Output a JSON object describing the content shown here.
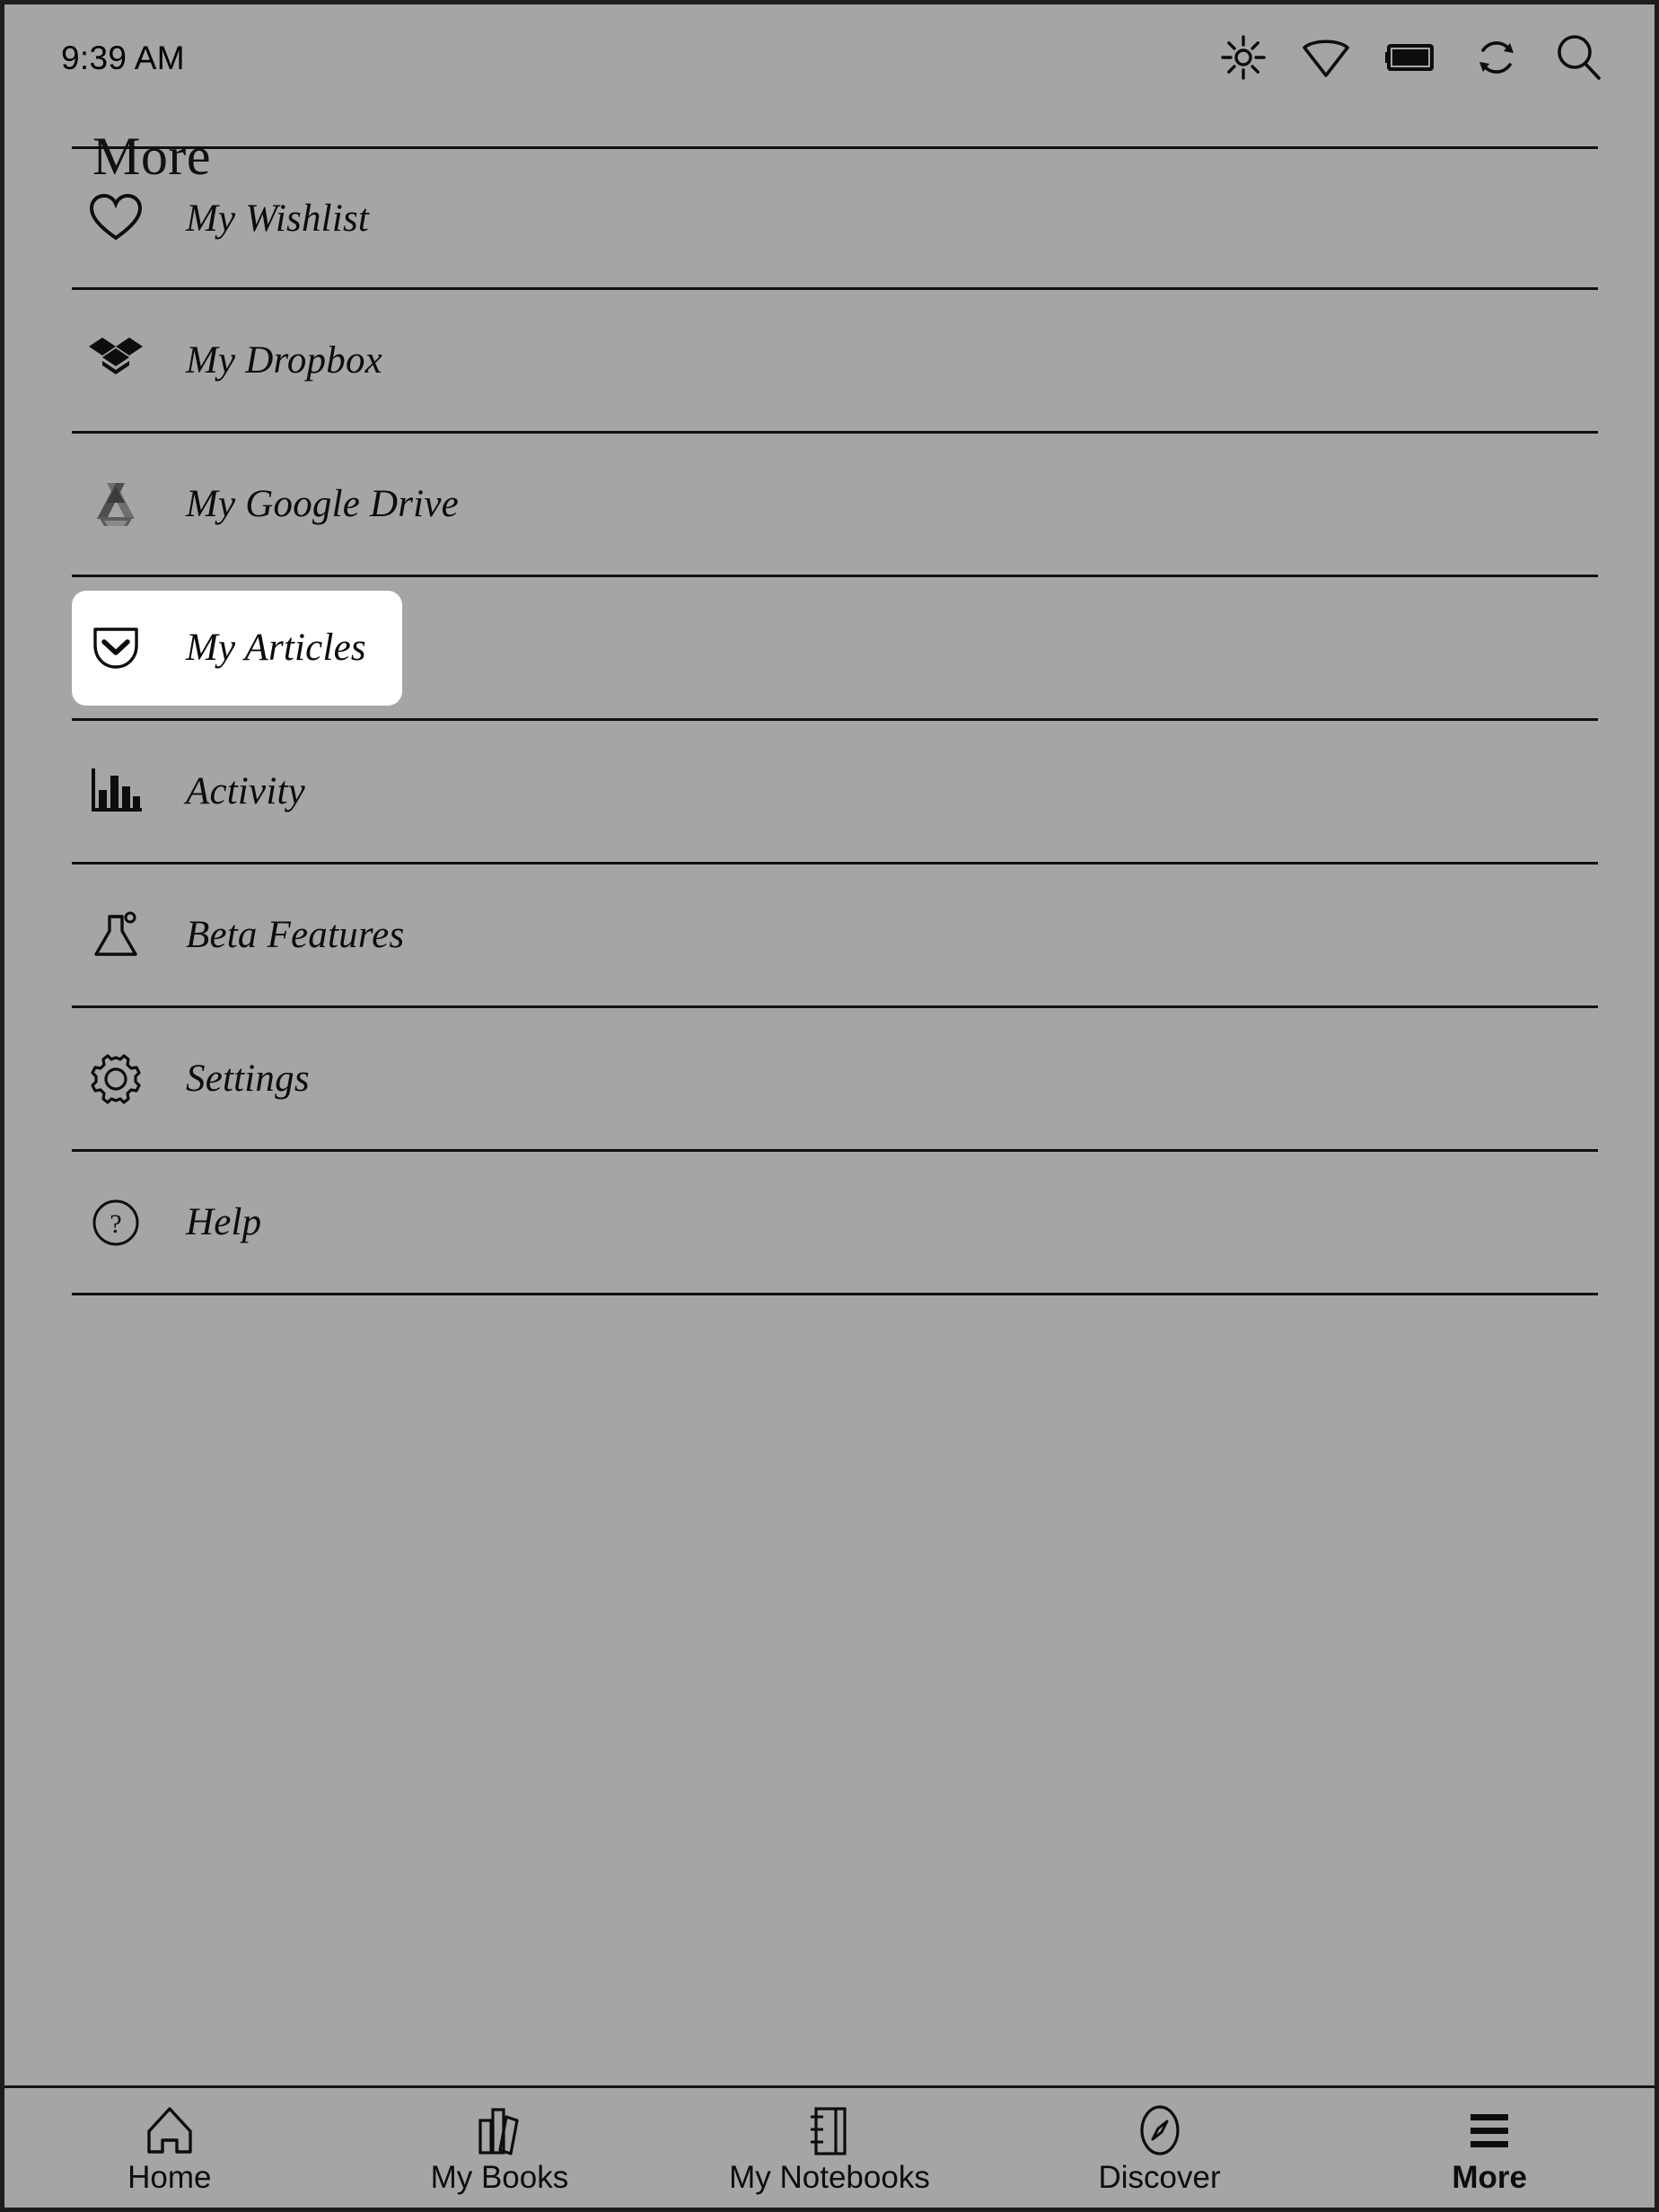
{
  "status_bar": {
    "time": "9:39 AM",
    "icons": [
      {
        "name": "brightness-icon",
        "label": "Brightness"
      },
      {
        "name": "wifi-icon",
        "label": "Wi-Fi"
      },
      {
        "name": "battery-icon",
        "label": "Battery"
      },
      {
        "name": "sync-icon",
        "label": "Sync"
      },
      {
        "name": "search-icon",
        "label": "Search"
      }
    ]
  },
  "header": {
    "title": "More"
  },
  "menu": {
    "items": [
      {
        "label": "My Wishlist",
        "icon": "heart-icon",
        "selected": false
      },
      {
        "label": "My Dropbox",
        "icon": "dropbox-icon",
        "selected": false
      },
      {
        "label": "My Google Drive",
        "icon": "google-drive-icon",
        "selected": false
      },
      {
        "label": "My Articles",
        "icon": "pocket-icon",
        "selected": true
      },
      {
        "label": "Activity",
        "icon": "bar-chart-icon",
        "selected": false
      },
      {
        "label": "Beta Features",
        "icon": "flask-icon",
        "selected": false
      },
      {
        "label": "Settings",
        "icon": "gear-icon",
        "selected": false
      },
      {
        "label": "Help",
        "icon": "question-circle-icon",
        "selected": false
      }
    ]
  },
  "bottom_nav": {
    "items": [
      {
        "label": "Home",
        "icon": "home-icon",
        "active": false
      },
      {
        "label": "My Books",
        "icon": "books-icon",
        "active": false
      },
      {
        "label": "My Notebooks",
        "icon": "notebook-icon",
        "active": false
      },
      {
        "label": "Discover",
        "icon": "compass-icon",
        "active": false
      },
      {
        "label": "More",
        "icon": "hamburger-icon",
        "active": true
      }
    ]
  },
  "colors": {
    "background": "#a5a5a5",
    "selected_background": "#ffffff",
    "foreground": "#0d0d0d",
    "divider": "#101010"
  }
}
